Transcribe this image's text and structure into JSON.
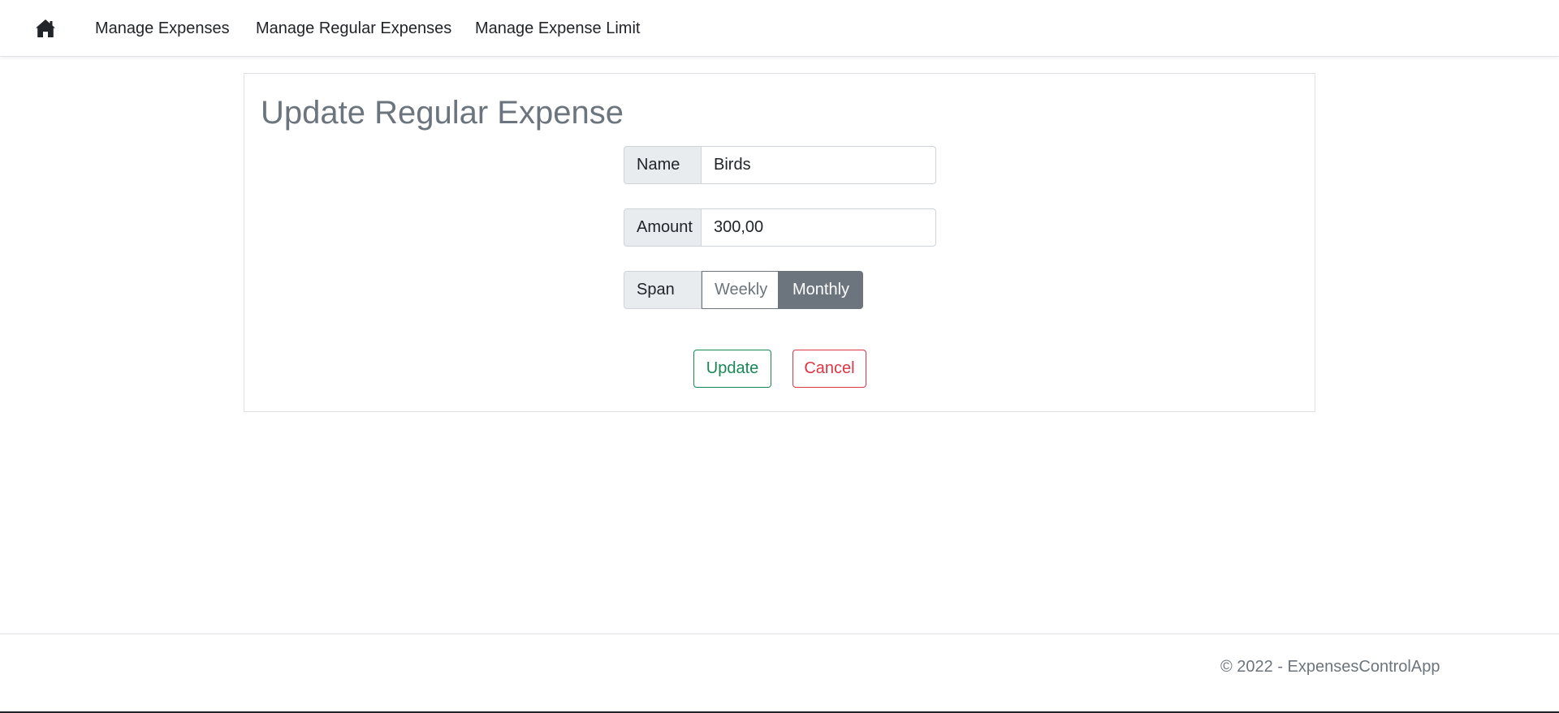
{
  "nav": {
    "home_icon": "home-icon",
    "items": [
      {
        "label": "Manage Expenses"
      },
      {
        "label": "Manage Regular Expenses"
      },
      {
        "label": "Manage Expense Limit"
      }
    ]
  },
  "main": {
    "title": "Update Regular Expense",
    "fields": {
      "name": {
        "label": "Name",
        "value": "Birds"
      },
      "amount": {
        "label": "Amount",
        "value": "300,00"
      },
      "span": {
        "label": "Span",
        "options": [
          "Weekly",
          "Monthly"
        ],
        "selected": "Monthly"
      }
    },
    "actions": {
      "update_label": "Update",
      "cancel_label": "Cancel"
    }
  },
  "footer": {
    "text": "© 2022 - ExpensesControlApp"
  },
  "colors": {
    "success": "#198754",
    "danger": "#dc3545",
    "secondary": "#6c757d",
    "label_bg": "#e9ecef"
  }
}
